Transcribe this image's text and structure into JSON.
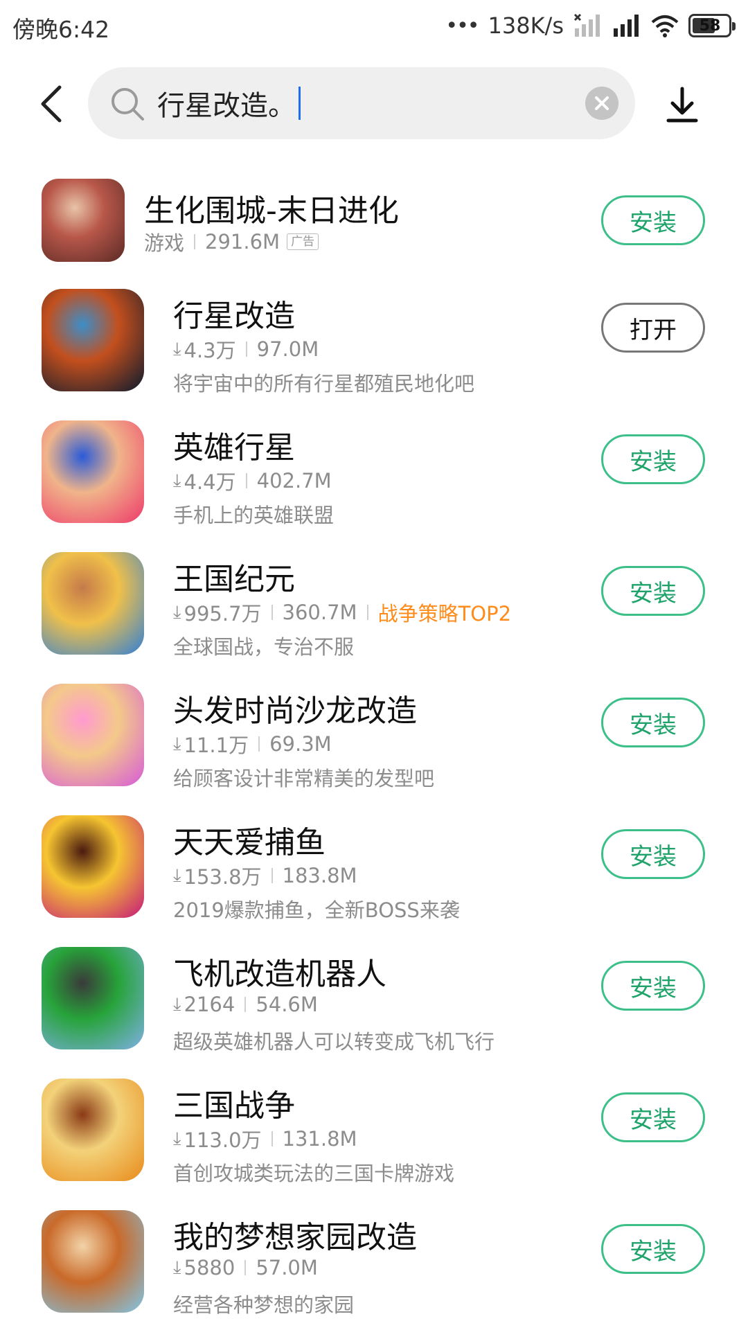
{
  "status_bar": {
    "time": "傍晚6:42",
    "dots": "•••",
    "net_speed": "138K/s",
    "battery": "58"
  },
  "search": {
    "query": "行星改造。"
  },
  "apps": [
    {
      "name": "生化围城-末日进化",
      "category": "游戏",
      "size": "291.6M",
      "ad_label": "广告",
      "button": "安装",
      "icon": "zombie-city-game-icon",
      "colors": [
        "#5a2a25",
        "#b8574a",
        "#e8c4a8"
      ]
    },
    {
      "name": "行星改造",
      "downloads": "4.3万",
      "size": "97.0M",
      "desc": "将宇宙中的所有行星都殖民地化吧",
      "button": "打开",
      "icon": "planet-game-icon",
      "colors": [
        "#0b1a2e",
        "#c34f1d",
        "#3c8ec9"
      ]
    },
    {
      "name": "英雄行星",
      "downloads": "4.4万",
      "size": "402.7M",
      "desc": "手机上的英雄联盟",
      "button": "安装",
      "icon": "hero-planet-game-icon",
      "colors": [
        "#ee3a6a",
        "#f0b48a",
        "#2a5bd8"
      ]
    },
    {
      "name": "王国纪元",
      "downloads": "995.7万",
      "size": "360.7M",
      "tag": "战争策略TOP2",
      "desc": "全球国战，专治不服",
      "button": "安装",
      "icon": "kingdom-era-game-icon",
      "colors": [
        "#2f7fd6",
        "#f0c04a",
        "#c57a4a"
      ]
    },
    {
      "name": "头发时尚沙龙改造",
      "downloads": "11.1万",
      "size": "69.3M",
      "desc": "给顾客设计非常精美的发型吧",
      "button": "安装",
      "icon": "hair-salon-game-icon",
      "colors": [
        "#d65ad8",
        "#f4c98a",
        "#ff9ad0"
      ]
    },
    {
      "name": "天天爱捕鱼",
      "downloads": "153.8万",
      "size": "183.8M",
      "desc": "2019爆款捕鱼，全新BOSS来袭",
      "button": "安装",
      "icon": "fishing-game-icon",
      "colors": [
        "#c4177a",
        "#f6c531",
        "#4a1a10"
      ]
    },
    {
      "name": "飞机改造机器人",
      "downloads": "2164",
      "size": "54.6M",
      "desc": "超级英雄机器人可以转变成飞机飞行",
      "button": "安装",
      "icon": "robot-plane-game-icon",
      "colors": [
        "#7fb0e6",
        "#27a33a",
        "#3a3a3a"
      ]
    },
    {
      "name": "三国战争",
      "downloads": "113.0万",
      "size": "131.8M",
      "desc": "首创攻城类玩法的三国卡牌游戏",
      "button": "安装",
      "icon": "three-kingdoms-game-icon",
      "colors": [
        "#e88a1a",
        "#f3d27a",
        "#8a3a16"
      ]
    },
    {
      "name": "我的梦想家园改造",
      "downloads": "5880",
      "size": "57.0M",
      "desc": "经营各种梦想的家园",
      "button": "安装",
      "icon": "dream-home-game-icon",
      "colors": [
        "#7fc6e8",
        "#c96a2a",
        "#f2d3a8"
      ]
    }
  ],
  "colors": {
    "install_green": "#3dbf8a",
    "tag_orange": "#ff8c1a",
    "meta_gray": "#8c8c8c"
  }
}
